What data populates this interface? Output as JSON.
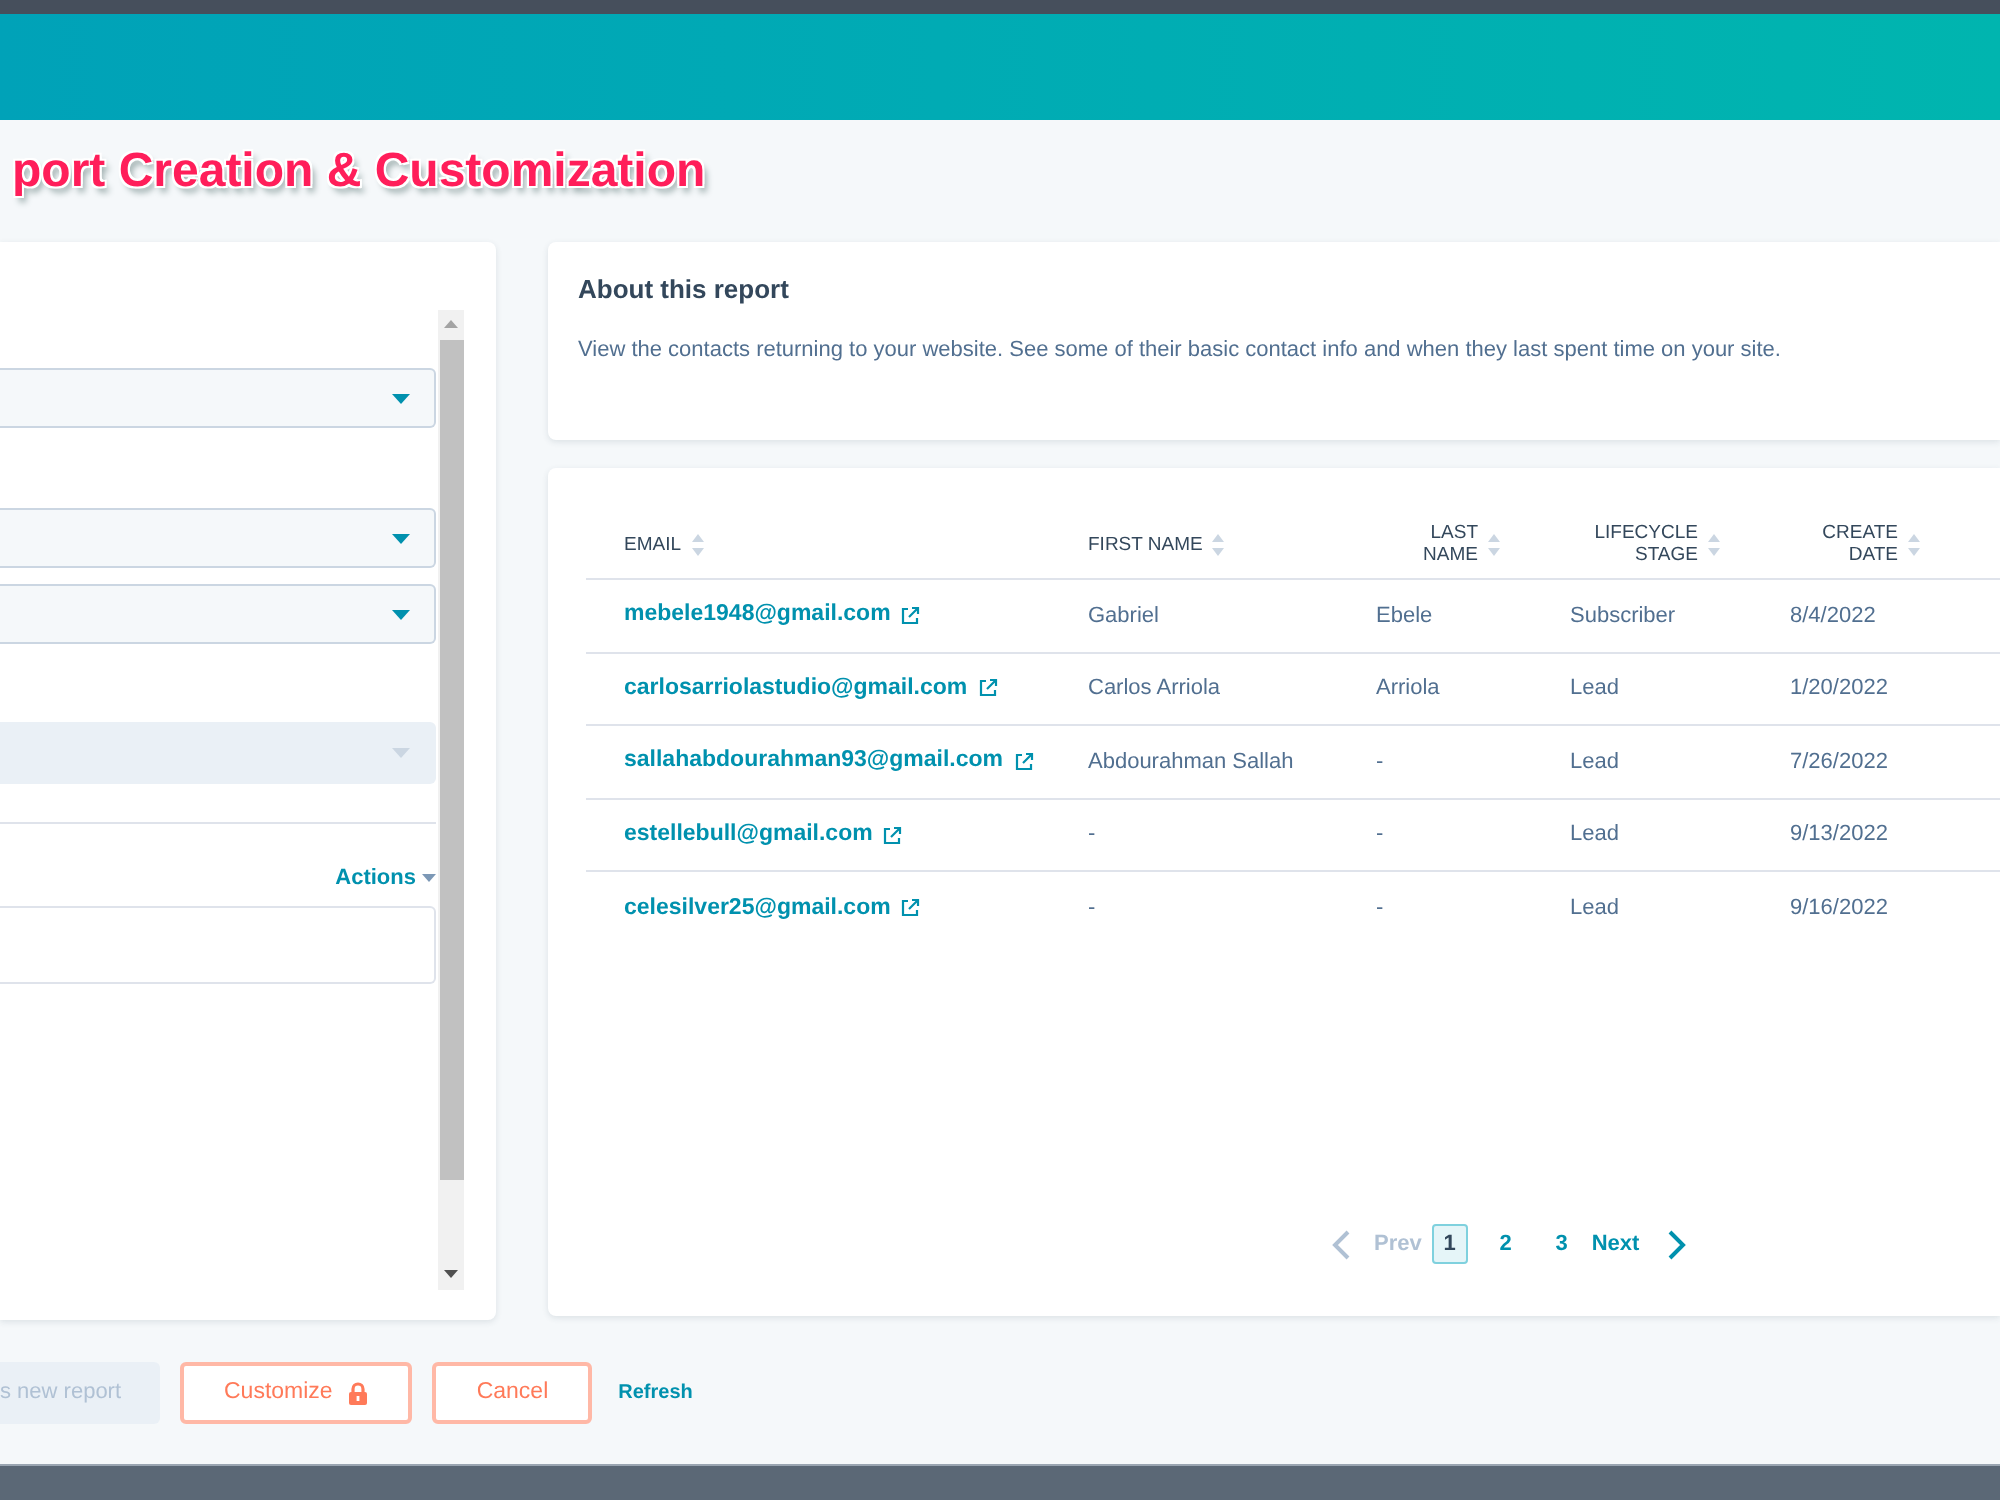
{
  "title": "port Creation & Customization",
  "settings_panel": {
    "dropdowns": [
      {
        "disabled": false
      },
      {
        "disabled": false
      },
      {
        "disabled": false
      },
      {
        "disabled": true
      }
    ],
    "actions_link": "Actions"
  },
  "about": {
    "title": "About this report",
    "description": "View the contacts returning to your website. See some of their basic contact info and when they last spent time on your site."
  },
  "table": {
    "columns": [
      "EMAIL",
      "FIRST NAME",
      "LAST NAME",
      "LIFECYCLE STAGE",
      "CREATE DATE"
    ],
    "rows": [
      {
        "email": "mebele1948@gmail.com",
        "first_name": "Gabriel",
        "last_name": "Ebele",
        "lifecycle_stage": "Subscriber",
        "create_date": "8/4/2022"
      },
      {
        "email": "carlosarriolastudio@gmail.com",
        "first_name": "Carlos Arriola",
        "last_name": "Arriola",
        "lifecycle_stage": "Lead",
        "create_date": "1/20/2022"
      },
      {
        "email": "sallahabdourahman93@gmail.com",
        "first_name": "Abdourahman Sallah",
        "last_name": "-",
        "lifecycle_stage": "Lead",
        "create_date": "7/26/2022"
      },
      {
        "email": "estellebull@gmail.com",
        "first_name": "-",
        "last_name": "-",
        "lifecycle_stage": "Lead",
        "create_date": "9/13/2022"
      },
      {
        "email": "celesilver25@gmail.com",
        "first_name": "-",
        "last_name": "-",
        "lifecycle_stage": "Lead",
        "create_date": "9/16/2022"
      }
    ]
  },
  "pagination": {
    "prev": {
      "label": "Prev",
      "disabled": true
    },
    "pages": [
      {
        "label": "1",
        "selected": true
      },
      {
        "label": "2",
        "selected": false
      },
      {
        "label": "3",
        "selected": false
      }
    ],
    "next": {
      "label": "Next",
      "disabled": false
    }
  },
  "buttons": [
    {
      "label": "s new report",
      "kind": "primary",
      "disabled": true,
      "locked": false
    },
    {
      "label": "Customize",
      "kind": "secondary",
      "disabled": false,
      "locked": true
    },
    {
      "label": "Cancel",
      "kind": "secondary",
      "disabled": false,
      "locked": false
    },
    {
      "label": "Refresh",
      "kind": "link",
      "disabled": false,
      "locked": false
    }
  ]
}
